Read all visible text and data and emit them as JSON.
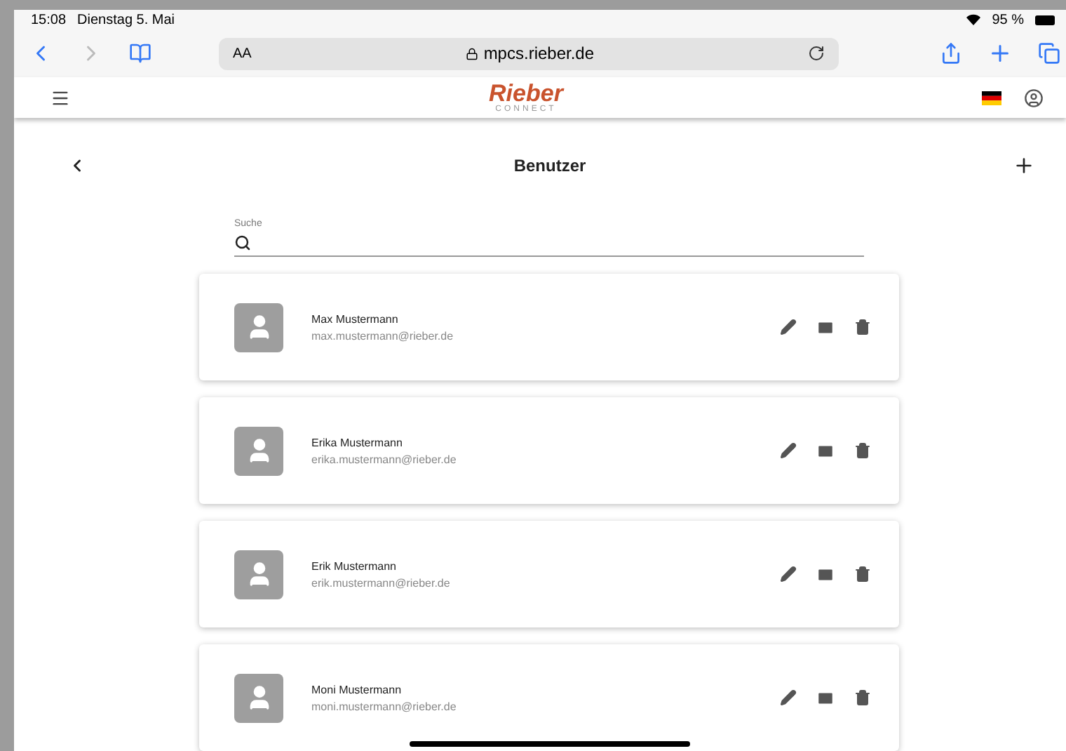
{
  "status_bar": {
    "time": "15:08",
    "date": "Dienstag 5. Mai",
    "battery": "95 %"
  },
  "browser": {
    "text_size": "AA",
    "url": "mpcs.rieber.de"
  },
  "app_header": {
    "logo": "Rieber",
    "logo_sub": "CONNECT"
  },
  "page": {
    "title": "Benutzer"
  },
  "search": {
    "label": "Suche"
  },
  "users": [
    {
      "name": "Max Mustermann",
      "email": "max.mustermann@rieber.de"
    },
    {
      "name": "Erika Mustermann",
      "email": "erika.mustermann@rieber.de"
    },
    {
      "name": "Erik Mustermann",
      "email": "erik.mustermann@rieber.de"
    },
    {
      "name": "Moni Mustermann",
      "email": "moni.mustermann@rieber.de"
    }
  ]
}
